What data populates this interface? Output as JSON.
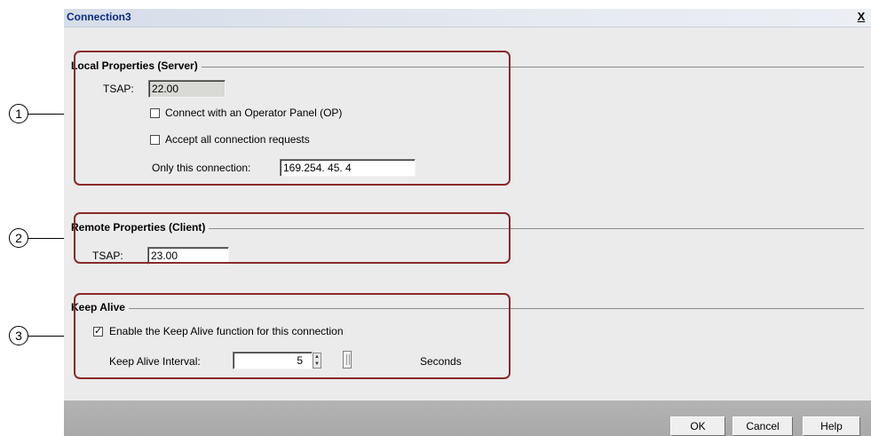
{
  "dialog": {
    "title": "Connection3",
    "close_label": "X"
  },
  "local": {
    "group_title": "Local Properties (Server)",
    "tsap_label": "TSAP:",
    "tsap_value": "22.00",
    "connect_op_label": "Connect with an Operator Panel (OP)",
    "connect_op_checked": false,
    "accept_all_label": "Accept all connection requests",
    "accept_all_checked": false,
    "only_conn_label": "Only this connection:",
    "only_conn_value": "169.254. 45.  4"
  },
  "remote": {
    "group_title": "Remote Properties (Client)",
    "tsap_label": "TSAP:",
    "tsap_value": "23.00"
  },
  "keepalive": {
    "group_title": "Keep Alive",
    "enable_label": "Enable the Keep Alive function for this connection",
    "enable_checked": true,
    "check_mark": "✓",
    "interval_label": "Keep Alive  Interval:",
    "interval_value": "5",
    "unit_label": "Seconds"
  },
  "footer": {
    "ok_label": "OK",
    "cancel_label": "Cancel",
    "help_label": "Help"
  },
  "markers": [
    "1",
    "2",
    "3"
  ],
  "colors": {
    "callout_border": "#8b2a2a",
    "title_text": "#0b2a86",
    "dialog_bg": "#ebebeb"
  }
}
